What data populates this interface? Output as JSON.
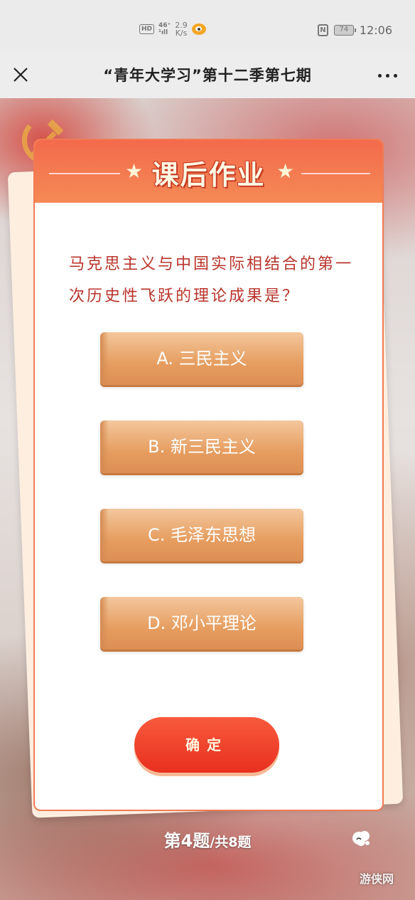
{
  "status_bar": {
    "hd": "HD",
    "network": "46⁺",
    "signal_sub": "¹ıll",
    "speed_value": "2.9",
    "speed_unit": "K/s",
    "nfc": "N",
    "battery": "74",
    "time": "12:06"
  },
  "nav": {
    "title": "“青年大学习”第十二季第七期"
  },
  "card": {
    "title": "课后作业",
    "question": "马克思主义与中国实际相结合的第一次历史性飞跃的理论成果是？",
    "options": [
      {
        "label": "A. 三民主义"
      },
      {
        "label": "B. 新三民主义"
      },
      {
        "label": "C. 毛泽东思想"
      },
      {
        "label": "D. 邓小平理论"
      }
    ],
    "confirm_label": "确定"
  },
  "progress": {
    "current": "第4题",
    "total": "/共8题"
  },
  "watermark": "游侠网",
  "colors": {
    "header": "#f36a4c",
    "question_text": "#b9342b",
    "option": "#e69d5f",
    "confirm": "#f0452d"
  },
  "icons": [
    "close-icon",
    "more-icon",
    "star-icon",
    "music-icon",
    "weibo-icon",
    "nfc-icon",
    "battery-icon"
  ]
}
